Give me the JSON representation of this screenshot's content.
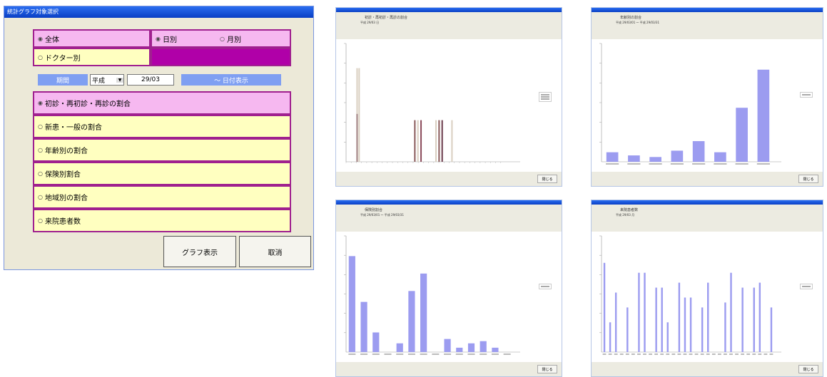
{
  "dialog": {
    "title": "統計グラフ対象選択",
    "whole": "全体",
    "doctor": "ドクター別",
    "daily": "日別",
    "monthly": "月別",
    "period_label": "期間",
    "era": "平成",
    "era_arrow": "▼",
    "date": "29/03",
    "range_label": "〜  日付表示",
    "options": [
      "初診・再初診・再診の割合",
      "新患・一般の割合",
      "年齢別の割合",
      "保険別割合",
      "地域別の割合",
      "来院患者数"
    ],
    "graph_button": "グラフ表示",
    "cancel_button": "取消"
  },
  "charts": [
    {
      "title": "初診・再初診・再診の割合",
      "subtitle": "平成 29/03 日",
      "close": "閉じる",
      "legend": [
        "",
        "",
        ""
      ]
    },
    {
      "title": "年齢別の割合",
      "subtitle": "平成 29/03/01 〜 平成 29/03/31",
      "close": "閉じる",
      "legend": [
        ""
      ]
    },
    {
      "title": "保険別割合",
      "subtitle": "平成 29/03/01 〜 平成 29/03/31",
      "close": "閉じる",
      "legend": [
        ""
      ]
    },
    {
      "title": "来院患者数",
      "subtitle": "平成 29/03 月",
      "close": "閉じる",
      "legend": [
        ""
      ]
    }
  ],
  "chart_data": [
    {
      "type": "bar",
      "series": [
        {
          "values": [
            0,
            27,
            27,
            0,
            0,
            0,
            0,
            0,
            0,
            0,
            0,
            0,
            0,
            0,
            0,
            0,
            0,
            0,
            0,
            0,
            0,
            0,
            0,
            0,
            0,
            0,
            0,
            0,
            0,
            0,
            0
          ]
        },
        {
          "values": [
            0,
            14,
            0,
            0,
            0,
            0,
            0,
            0,
            0,
            0,
            0,
            0,
            0,
            0,
            0,
            0,
            0,
            0,
            0,
            0,
            0,
            0,
            0,
            0,
            0,
            0,
            0,
            0,
            0,
            0,
            0
          ]
        },
        {
          "values": [
            0,
            0,
            0,
            0,
            0,
            0,
            0,
            0,
            0,
            0,
            0,
            0,
            0,
            0,
            0,
            0,
            0,
            0,
            0,
            0,
            0,
            0,
            0,
            0,
            0,
            0,
            0,
            0,
            0,
            0,
            0
          ]
        }
      ],
      "colors": [
        "#d9cfc0",
        "#a37c7c",
        "#c6bdb0"
      ],
      "bars": [
        [
          2,
          0.9,
          "#d9cfc0"
        ],
        [
          2.4,
          0.9,
          "#d9cfc0"
        ],
        [
          2,
          0.46,
          "#9f7f7f"
        ],
        [
          13.2,
          0.4,
          "#8a5a5a"
        ],
        [
          13.8,
          0.4,
          "#d9cfc0"
        ],
        [
          14.4,
          0.4,
          "#8a4a5a"
        ],
        [
          17.3,
          0.4,
          "#d9cfc0"
        ],
        [
          17.9,
          0.4,
          "#8a5a5a"
        ],
        [
          18.5,
          0.4,
          "#6a3a4a"
        ],
        [
          20.4,
          0.4,
          "#d9cfc0"
        ]
      ]
    },
    {
      "type": "bar",
      "values": [
        6,
        4,
        3,
        7,
        13,
        6,
        34,
        58
      ],
      "color": "#9c9cf0",
      "ymax": 70
    },
    {
      "type": "bar",
      "values": [
        44,
        23,
        9,
        0,
        4,
        28,
        36,
        0,
        6,
        2,
        4,
        5,
        2,
        0
      ],
      "color": "#9c9cf0",
      "ymax": 50
    },
    {
      "type": "bar",
      "values": [
        18,
        6,
        12,
        0,
        9,
        0,
        16,
        16,
        0,
        13,
        13,
        6,
        0,
        14,
        11,
        11,
        0,
        9,
        14,
        0,
        0,
        10,
        16,
        0,
        13,
        0,
        13,
        14,
        0,
        9
      ],
      "color": "#9c9cf0",
      "ymax": 22
    }
  ]
}
